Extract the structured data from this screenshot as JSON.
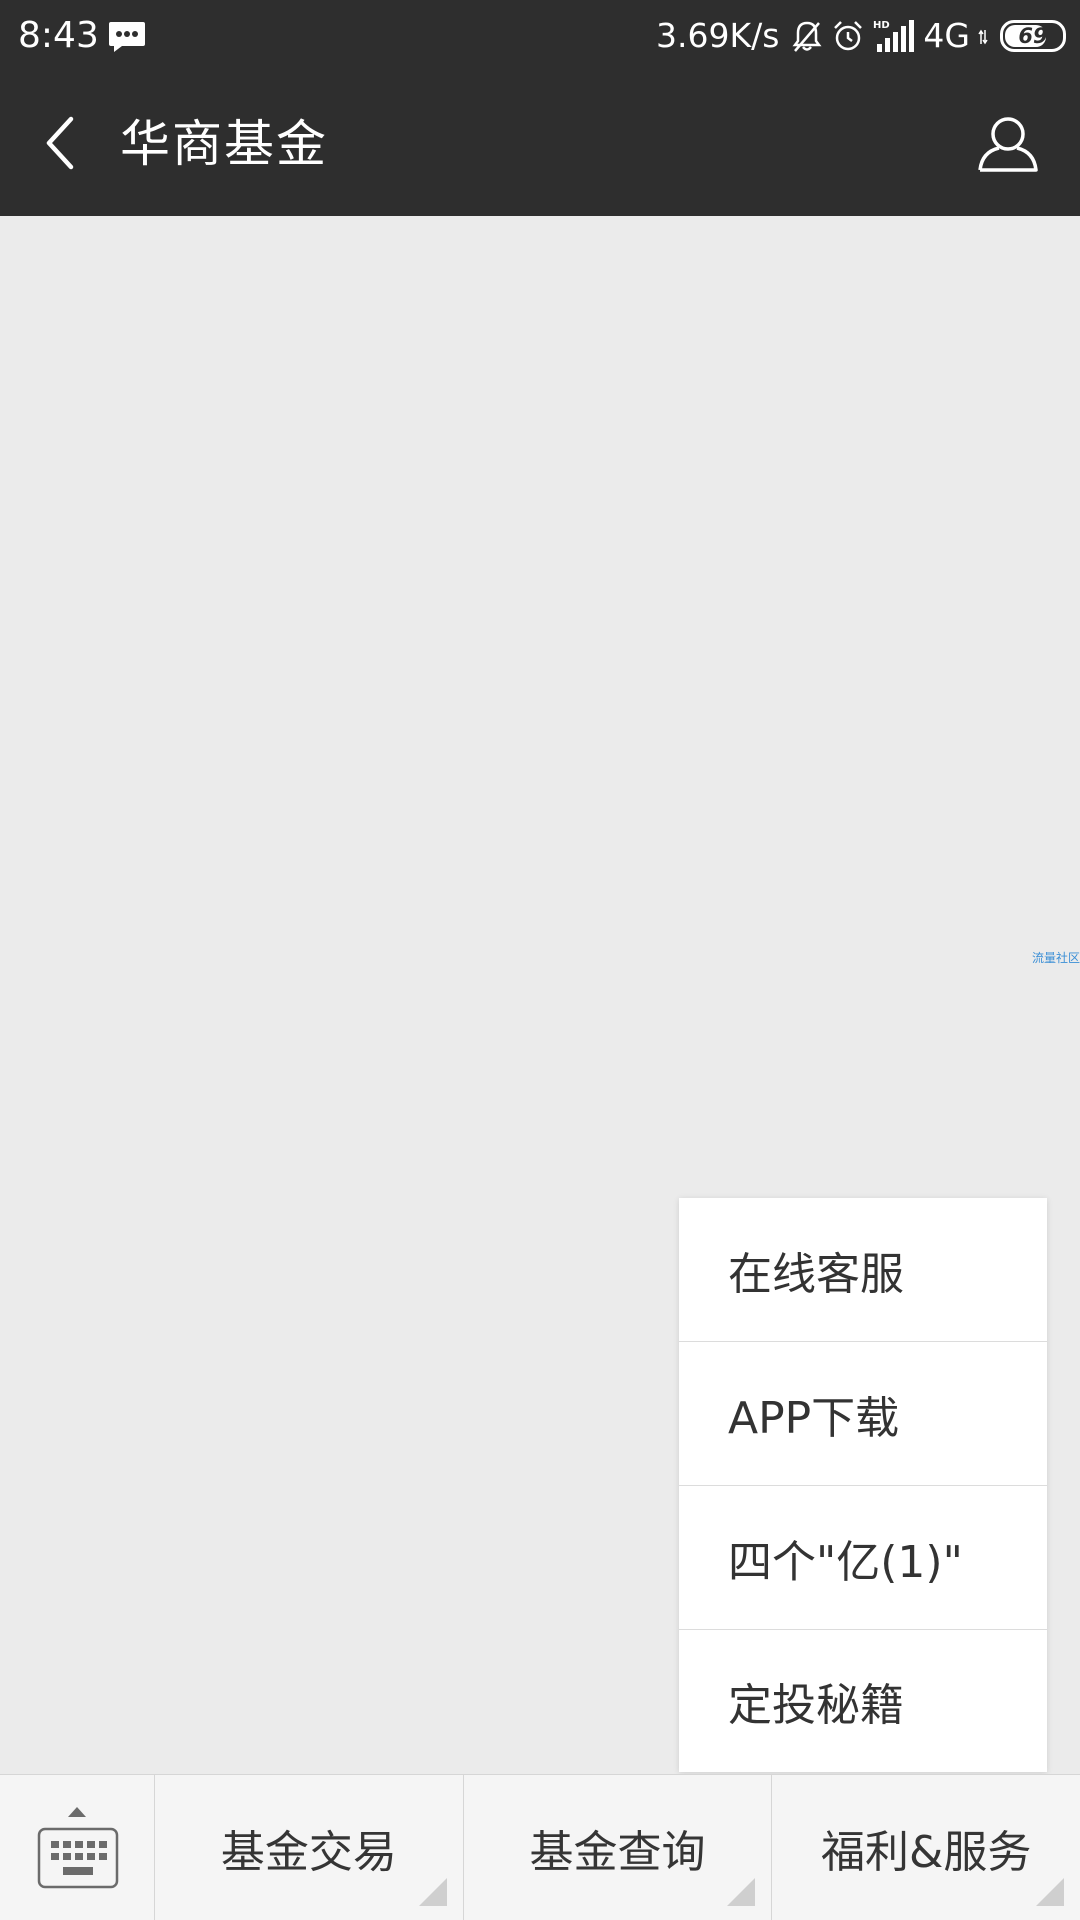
{
  "status_bar": {
    "time": "8:43",
    "message_icon": "chat-bubble-icon",
    "speed": "3.69K/s",
    "mute_icon": "bell-off-icon",
    "alarm_icon": "alarm-icon",
    "signal_icon": "hd-signal-icon",
    "network": "4G",
    "battery_level": "69"
  },
  "header": {
    "back_icon": "chevron-left-icon",
    "title": "华商基金",
    "profile_icon": "person-icon"
  },
  "chat": {
    "watermark": "流量社区"
  },
  "popup_menu": {
    "items": [
      {
        "label": "在线客服"
      },
      {
        "label": "APP下载"
      },
      {
        "label": "四个\"亿(1)\""
      },
      {
        "label": "定投秘籍"
      }
    ]
  },
  "bottom_bar": {
    "keyboard_icon": "keyboard-icon",
    "tabs": [
      {
        "label": "基金交易"
      },
      {
        "label": "基金查询"
      },
      {
        "label": "福利&服务"
      }
    ]
  },
  "colors": {
    "header_bg": "#2e2e2e",
    "chat_bg": "#ebebeb",
    "menu_bg": "#ffffff",
    "watermark": "#3b8fd6"
  }
}
